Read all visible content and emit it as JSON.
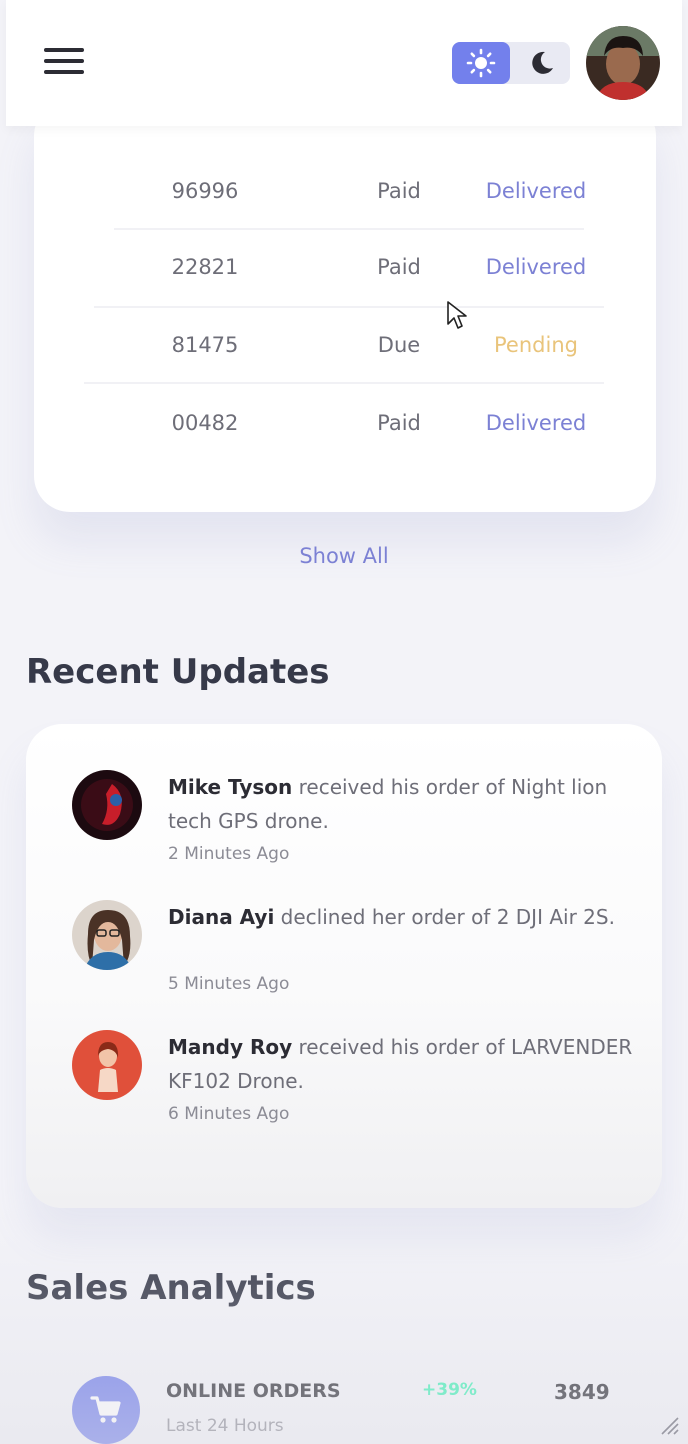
{
  "header": {
    "menu_icon": "hamburger-menu-icon",
    "theme_light_icon": "sun-icon",
    "theme_dark_icon": "moon-icon",
    "accent": "#7380ec"
  },
  "orders": {
    "rows": [
      {
        "id": "96996",
        "payment": "Paid",
        "status": "Delivered"
      },
      {
        "id": "22821",
        "payment": "Paid",
        "status": "Delivered"
      },
      {
        "id": "81475",
        "payment": "Due",
        "status": "Pending"
      },
      {
        "id": "00482",
        "payment": "Paid",
        "status": "Delivered"
      }
    ],
    "show_all": "Show All"
  },
  "recent_updates": {
    "title": "Recent Updates",
    "items": [
      {
        "name": "Mike Tyson",
        "message": "received his order of Night lion tech GPS drone.",
        "time": "2 Minutes Ago"
      },
      {
        "name": "Diana Ayi",
        "message": "declined her order of 2 DJI Air 2S.",
        "time": "5 Minutes Ago"
      },
      {
        "name": "Mandy Roy",
        "message": "received his order of LARVENDER KF102 Drone.",
        "time": "6 Minutes Ago"
      }
    ]
  },
  "sales_analytics": {
    "title": "Sales Analytics",
    "items": [
      {
        "label": "ONLINE ORDERS",
        "sub": "Last 24 Hours",
        "percent": "+39%",
        "value": "3849",
        "icon": "shopping-cart-icon"
      }
    ]
  }
}
